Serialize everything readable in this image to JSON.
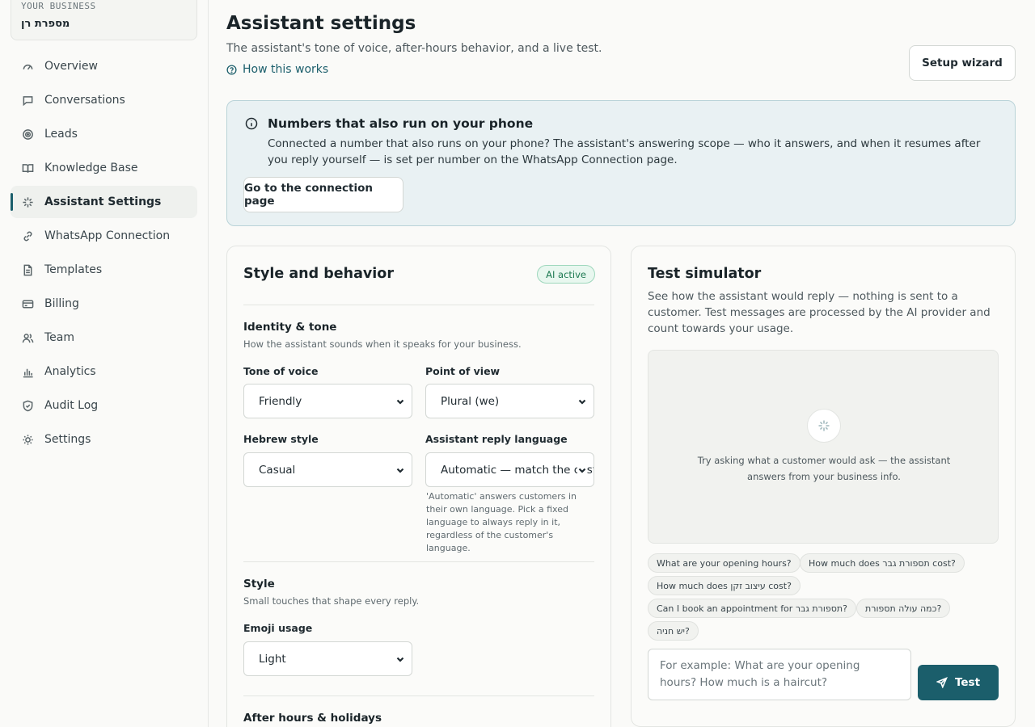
{
  "business": {
    "label": "YOUR BUSINESS",
    "name": "מספרת רן"
  },
  "nav": [
    {
      "label": "Overview",
      "icon": "gauge-icon"
    },
    {
      "label": "Conversations",
      "icon": "chat-bubble-icon"
    },
    {
      "label": "Leads",
      "icon": "target-icon"
    },
    {
      "label": "Knowledge Base",
      "icon": "book-icon"
    },
    {
      "label": "Assistant Settings",
      "icon": "sparkle-icon"
    },
    {
      "label": "WhatsApp Connection",
      "icon": "link-icon"
    },
    {
      "label": "Templates",
      "icon": "document-icon"
    },
    {
      "label": "Billing",
      "icon": "credit-card-icon"
    },
    {
      "label": "Team",
      "icon": "users-icon"
    },
    {
      "label": "Analytics",
      "icon": "bar-chart-icon"
    },
    {
      "label": "Audit Log",
      "icon": "shield-icon"
    },
    {
      "label": "Settings",
      "icon": "sun-gear-icon"
    }
  ],
  "active_nav": "Assistant Settings",
  "header": {
    "title": "Assistant settings",
    "subtitle": "The assistant's tone of voice, after-hours behavior, and a live test.",
    "how_link": "How this works",
    "wizard_button": "Setup wizard"
  },
  "banner": {
    "title": "Numbers that also run on your phone",
    "text": "Connected a number that also runs on your phone? The assistant's answering scope — who it answers, and when it resumes after you reply yourself — is set per number on the WhatsApp Connection page.",
    "button": "Go to the connection page"
  },
  "style_card": {
    "title": "Style and behavior",
    "badge": "AI active",
    "identity": {
      "title": "Identity & tone",
      "desc": "How the assistant sounds when it speaks for your business.",
      "tone_label": "Tone of voice",
      "tone_value": "Friendly",
      "pov_label": "Point of view",
      "pov_value": "Plural (we)",
      "hebrew_label": "Hebrew style",
      "hebrew_value": "Casual",
      "lang_label": "Assistant reply language",
      "lang_value": "Automatic — match the customer",
      "lang_hint": "'Automatic' answers customers in their own language. Pick a fixed language to always reply in it, regardless of the customer's language."
    },
    "style": {
      "title": "Style",
      "desc": "Small touches that shape every reply.",
      "emoji_label": "Emoji usage",
      "emoji_value": "Light"
    },
    "after_hours": {
      "title": "After hours & holidays"
    }
  },
  "simulator": {
    "title": "Test simulator",
    "desc": "See how the assistant would reply — nothing is sent to a customer. Test messages are processed by the AI provider and count towards your usage.",
    "empty": "Try asking what a customer would ask — the assistant answers from your business info.",
    "chips": [
      "What are your opening hours?",
      "How much does תספורת גבר cost?",
      "How much does עיצוב זקן cost?",
      "Can I book an appointment for תספורת גבר?",
      "כמה עולה תספורת?",
      "יש חניה?"
    ],
    "placeholder": "For example: What are your opening hours? How much is a haircut?",
    "test_button": "Test"
  },
  "colors": {
    "accent": "#1b5e6b",
    "badge_bg": "#e8f7ef",
    "badge_text": "#1e7a52",
    "banner_bg": "#e9f1f3"
  }
}
